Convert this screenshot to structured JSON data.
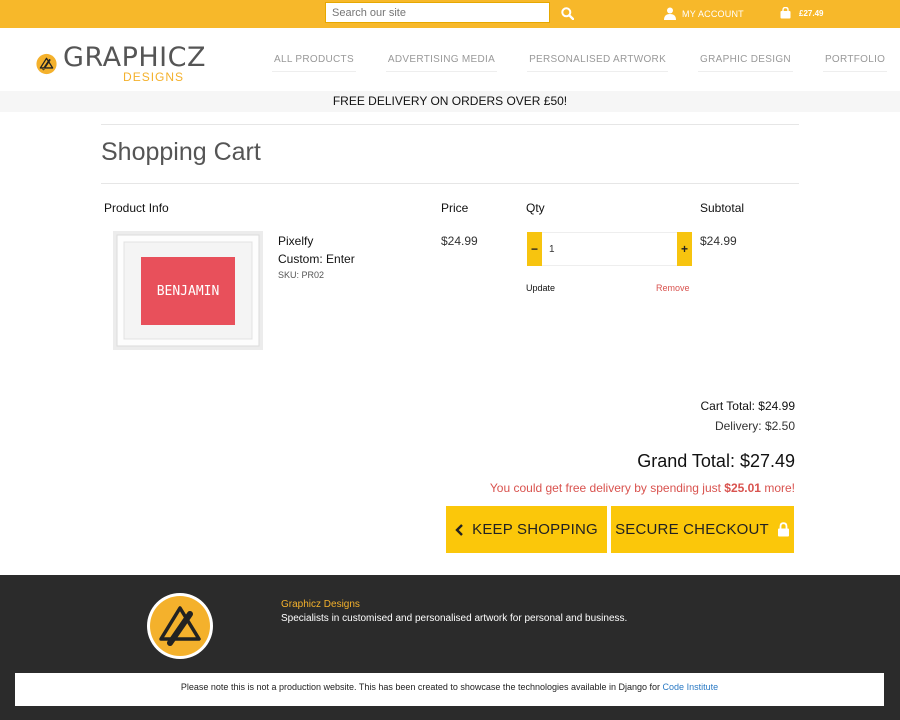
{
  "topbar": {
    "search_placeholder": "Search our site",
    "account_label": "MY ACCOUNT",
    "cart_total": "£27.49"
  },
  "header": {
    "logo_name": "GRAPHICZ",
    "logo_sub": "DESIGNS",
    "nav": [
      "ALL PRODUCTS",
      "ADVERTISING MEDIA",
      "PERSONALISED ARTWORK",
      "GRAPHIC DESIGN",
      "PORTFOLIO"
    ]
  },
  "promo": "FREE DELIVERY ON ORDERS OVER £50!",
  "page_title": "Shopping Cart",
  "table_headers": {
    "product_info": "Product Info",
    "price": "Price",
    "qty": "Qty",
    "subtotal": "Subtotal"
  },
  "cart_item": {
    "image_text": "BENJAMIN",
    "name": "Pixelfy",
    "custom_label": "Custom:",
    "custom_value": "Enter",
    "sku": "SKU: PR02",
    "price": "$24.99",
    "qty": "1",
    "subtotal": "$24.99",
    "update_label": "Update",
    "remove_label": "Remove"
  },
  "totals": {
    "cart_total": "Cart Total: $24.99",
    "delivery": "Delivery: $2.50",
    "grand_total": "Grand Total: $27.49",
    "free_delivery_prefix": "You could get free delivery by spending just ",
    "free_delivery_amount": "$25.01",
    "free_delivery_suffix": " more!"
  },
  "buttons": {
    "keep_shopping": "KEEP SHOPPING",
    "secure_checkout": "SECURE CHECKOUT"
  },
  "footer": {
    "name": "Graphicz Designs",
    "description": "Specialists in customised and personalised artwork for personal and business.",
    "notice_text": "Please note this is not a production website. This has been created to showcase the technologies available in Django for ",
    "notice_link": "Code Institute"
  },
  "colors": {
    "accent": "#f7b82a",
    "button": "#fbc70a",
    "remove": "#d9534f",
    "footer_bg": "#2b2b2b"
  }
}
